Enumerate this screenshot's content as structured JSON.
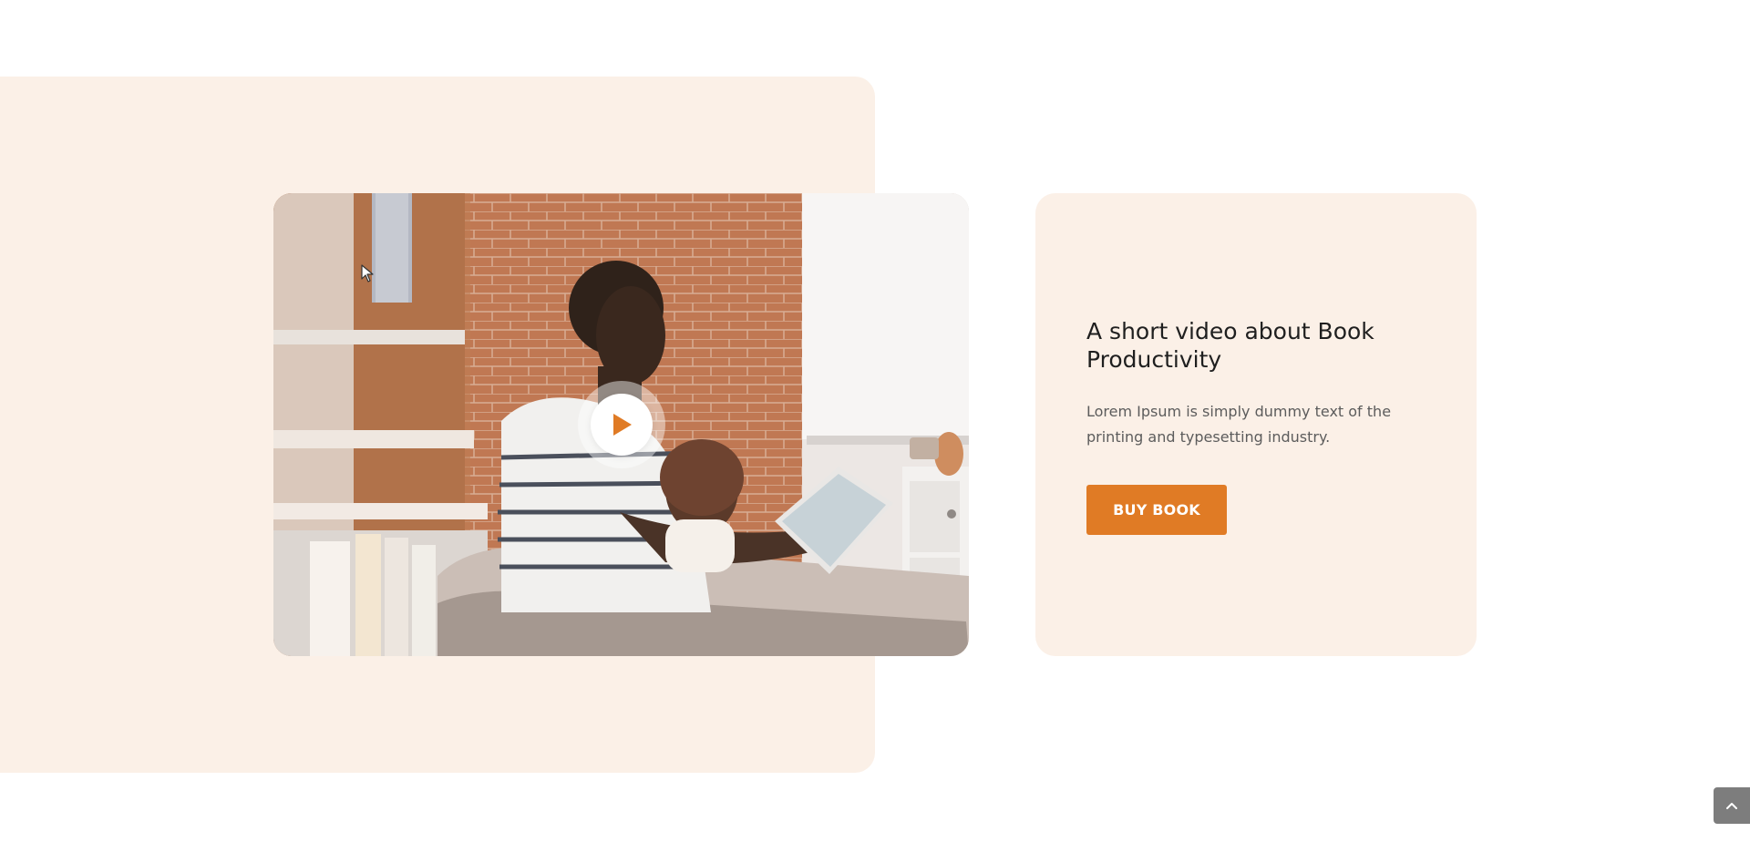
{
  "video": {
    "play_icon": "play-icon",
    "play_color": "#e07b25"
  },
  "info": {
    "title": "A short video about Book Productivity",
    "description": "Lorem Ipsum is simply dummy text of the printing and typesetting industry.",
    "button_label": "BUY BOOK",
    "button_color": "#e07b25"
  },
  "colors": {
    "accent": "#e07b25",
    "panel_bg": "#fbf0e7",
    "page_bg": "#ffffff"
  },
  "scroll_top": {
    "icon": "chevron-up-icon"
  }
}
